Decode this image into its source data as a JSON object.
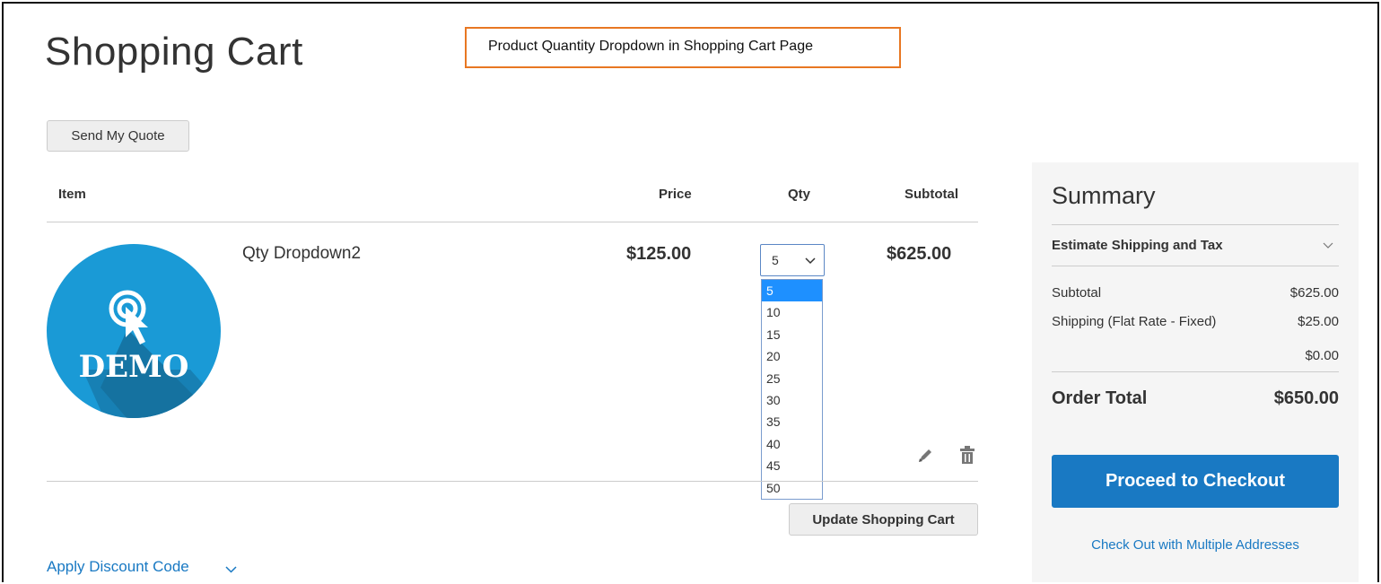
{
  "page": {
    "title": "Shopping Cart"
  },
  "callout": {
    "text": "Product Quantity Dropdown in Shopping Cart Page",
    "border_color": "#e87722"
  },
  "actions": {
    "send_quote": "Send My Quote",
    "update_cart": "Update Shopping Cart",
    "apply_discount": "Apply Discount Code"
  },
  "table": {
    "headers": {
      "item": "Item",
      "price": "Price",
      "qty": "Qty",
      "subtotal": "Subtotal"
    },
    "rows": [
      {
        "name": "Qty Dropdown2",
        "image_text": "DEMO",
        "price": "$125.00",
        "qty_selected": "5",
        "qty_options": [
          "5",
          "10",
          "15",
          "20",
          "25",
          "30",
          "35",
          "40",
          "45",
          "50"
        ],
        "subtotal": "$625.00",
        "icons": [
          "pencil-icon",
          "trash-icon"
        ]
      }
    ]
  },
  "summary": {
    "title": "Summary",
    "estimate_shipping": "Estimate Shipping and Tax",
    "lines": [
      {
        "label": "Subtotal",
        "value": "$625.00"
      },
      {
        "label": "Shipping (Flat Rate - Fixed)",
        "value": "$25.00"
      },
      {
        "label": "",
        "value": "$0.00"
      }
    ],
    "order_total_label": "Order Total",
    "order_total_value": "$650.00",
    "checkout_button": "Proceed to Checkout",
    "multi_address_link": "Check Out with Multiple Addresses"
  },
  "colors": {
    "primary": "#1979c3",
    "selected_option": "#1e90ff",
    "demo_circle": "#1a9ad6",
    "demo_shadow": "#156f9c",
    "summary_bg": "#f5f5f5"
  }
}
